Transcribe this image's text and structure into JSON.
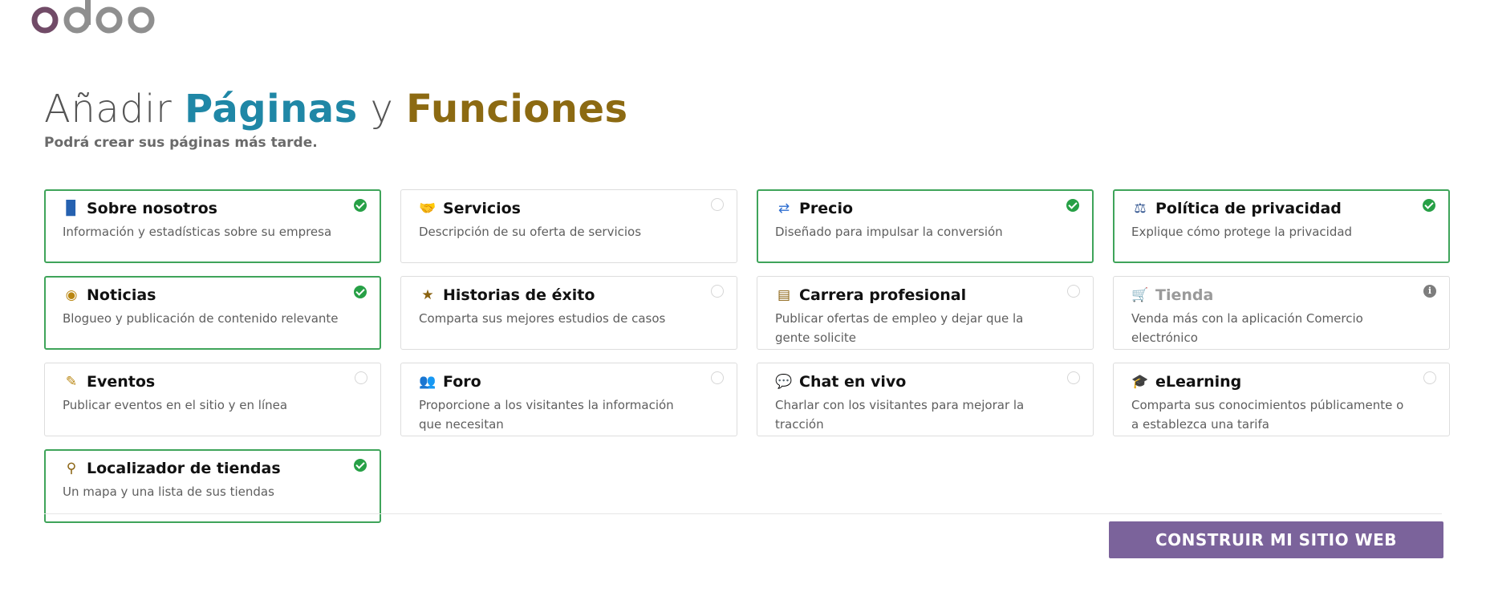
{
  "brand": {
    "logo_text": "odoo",
    "logo_colors": {
      "o1": "#714B67",
      "rest": "#8F8F8F"
    }
  },
  "header": {
    "title_part1": "Añadir",
    "title_part2": "Páginas",
    "title_part3": "y",
    "title_part4": "Funciones",
    "subtitle": "Podrá crear sus páginas más tarde."
  },
  "features": [
    {
      "icon": "book-icon",
      "glyph": "▉",
      "title": "Sobre nosotros",
      "description": "Información y estadísticas sobre su empresa",
      "state": "selected"
    },
    {
      "icon": "handshake-icon",
      "glyph": "🤝",
      "title": "Servicios",
      "description": "Descripción de su oferta de servicios",
      "state": "unselected"
    },
    {
      "icon": "random-icon",
      "glyph": "⇄",
      "title": "Precio",
      "description": "Diseñado para impulsar la conversión",
      "state": "selected"
    },
    {
      "icon": "gavel-icon",
      "glyph": "⚖",
      "title": "Política de privacidad",
      "description": "Explique cómo protege la privacidad",
      "state": "selected"
    },
    {
      "icon": "rss-icon",
      "glyph": "◉",
      "title": "Noticias",
      "description": "Blogueo y publicación de contenido relevante",
      "state": "selected"
    },
    {
      "icon": "star-icon",
      "glyph": "★",
      "title": "Historias de éxito",
      "description": "Comparta sus mejores estudios de casos",
      "state": "unselected"
    },
    {
      "icon": "id-card-icon",
      "glyph": "▤",
      "title": "Carrera profesional",
      "description": "Publicar ofertas de empleo y dejar que la gente solicite",
      "state": "unselected"
    },
    {
      "icon": "shopping-cart-icon",
      "glyph": "🛒",
      "title": "Tienda",
      "description": "Venda más con la aplicación Comercio electrónico",
      "state": "info"
    },
    {
      "icon": "ticket-icon",
      "glyph": "✎",
      "title": "Eventos",
      "description": "Publicar eventos en el sitio y en línea",
      "state": "unselected"
    },
    {
      "icon": "users-icon",
      "glyph": "👥",
      "title": "Foro",
      "description": "Proporcione a los visitantes la información que necesitan",
      "state": "unselected"
    },
    {
      "icon": "comments-icon",
      "glyph": "💬",
      "title": "Chat en vivo",
      "description": "Charlar con los visitantes para mejorar la tracción",
      "state": "unselected"
    },
    {
      "icon": "graduation-cap-icon",
      "glyph": "🎓",
      "title": "eLearning",
      "description": "Comparta sus conocimientos públicamente o a establezca una tarifa",
      "state": "unselected"
    },
    {
      "icon": "map-marker-icon",
      "glyph": "⚲",
      "title": "Localizador de tiendas",
      "description": "Un mapa y una lista de sus tiendas",
      "state": "selected"
    }
  ],
  "icon_colors": {
    "book-icon": "#2561b0",
    "handshake-icon": "#3a74c8",
    "random-icon": "#2f6fd1",
    "gavel-icon": "#2b4f8c",
    "rss-icon": "#b98611",
    "star-icon": "#8a6210",
    "id-card-icon": "#8a6210",
    "shopping-cart-icon": "#9a9a9a",
    "ticket-icon": "#b98611",
    "users-icon": "#8a6210",
    "comments-icon": "#9a6a10",
    "graduation-cap-icon": "#9a6a10",
    "map-marker-icon": "#8a6210"
  },
  "footer": {
    "build_button": "CONSTRUIR MI SITIO WEB"
  }
}
